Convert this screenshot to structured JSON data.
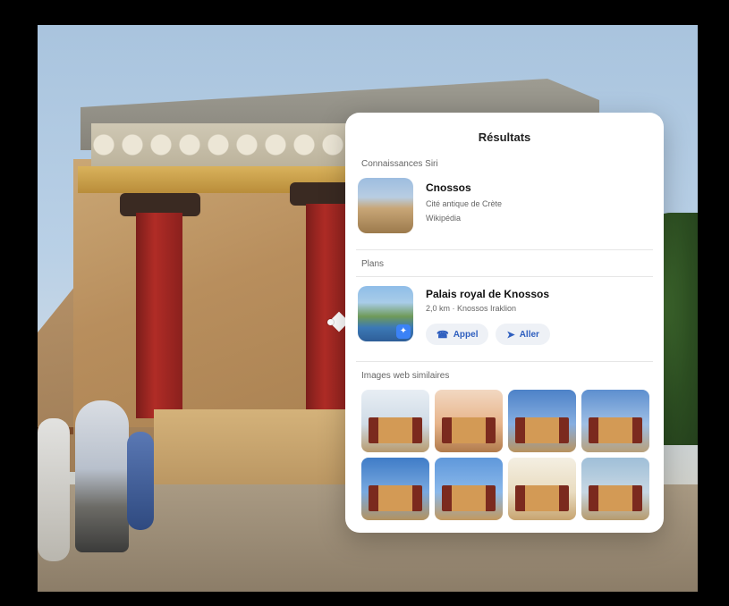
{
  "panel": {
    "title": "Résultats",
    "sections": {
      "knowledge": {
        "label": "Connaissances Siri",
        "item": {
          "title": "Cnossos",
          "subtitle": "Cité antique de Crète",
          "source": "Wikipédia"
        }
      },
      "maps": {
        "label": "Plans",
        "item": {
          "title": "Palais royal de Knossos",
          "subtitle": "2,0 km · Knossos Iraklion",
          "call_label": "Appel",
          "go_label": "Aller"
        }
      },
      "similar": {
        "label": "Images web similaires",
        "images": [
          "image-1",
          "image-2",
          "image-3",
          "image-4",
          "image-5",
          "image-6",
          "image-7",
          "image-8"
        ]
      }
    }
  },
  "icons": {
    "phone": "phone-icon",
    "navigation": "navigation-icon",
    "maps_badge": "maps-badge-icon"
  },
  "colors": {
    "accent": "#2f5fbf",
    "panel_bg": "#ffffff",
    "pill_bg": "#eef1f6"
  }
}
